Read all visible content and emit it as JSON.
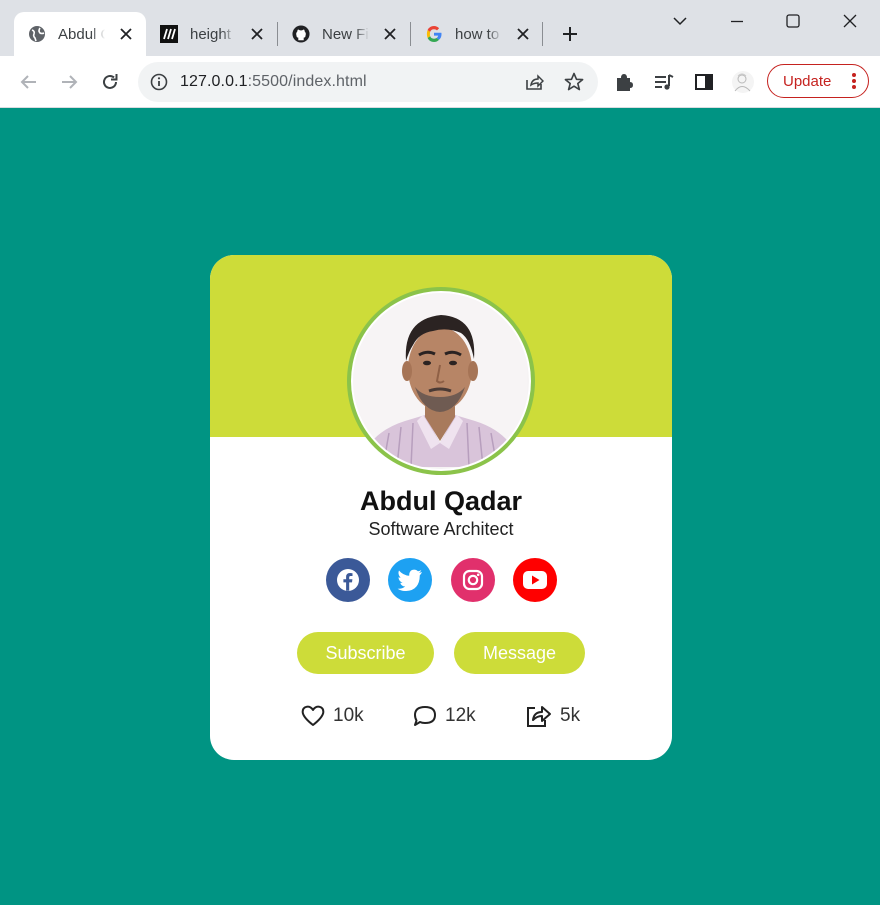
{
  "browser": {
    "tabs": [
      {
        "title": "Abdul Qadar",
        "icon": "globe-icon",
        "active": true
      },
      {
        "title": "height",
        "icon": "mdn-icon",
        "active": false
      },
      {
        "title": "New File",
        "icon": "github-icon",
        "active": false
      },
      {
        "title": "how to",
        "icon": "google-icon",
        "active": false
      }
    ],
    "url_host": "127.0.0.1",
    "url_path": ":5500/index.html",
    "update_label": "Update"
  },
  "card": {
    "name": "Abdul Qadar",
    "role": "Software Architect",
    "social": [
      {
        "name": "facebook",
        "icon": "facebook-icon",
        "color": "#3b5998"
      },
      {
        "name": "twitter",
        "icon": "twitter-icon",
        "color": "#1da1f2"
      },
      {
        "name": "instagram",
        "icon": "instagram-icon",
        "color": "#e1306c"
      },
      {
        "name": "youtube",
        "icon": "youtube-icon",
        "color": "#ff0000"
      }
    ],
    "buttons": {
      "subscribe": "Subscribe",
      "message": "Message"
    },
    "stats": {
      "likes": "10k",
      "comments": "12k",
      "shares": "5k"
    }
  },
  "colors": {
    "page_background": "#009483",
    "banner": "#cddc39",
    "avatar_ring": "#8bc34a",
    "button": "#cddc39"
  }
}
